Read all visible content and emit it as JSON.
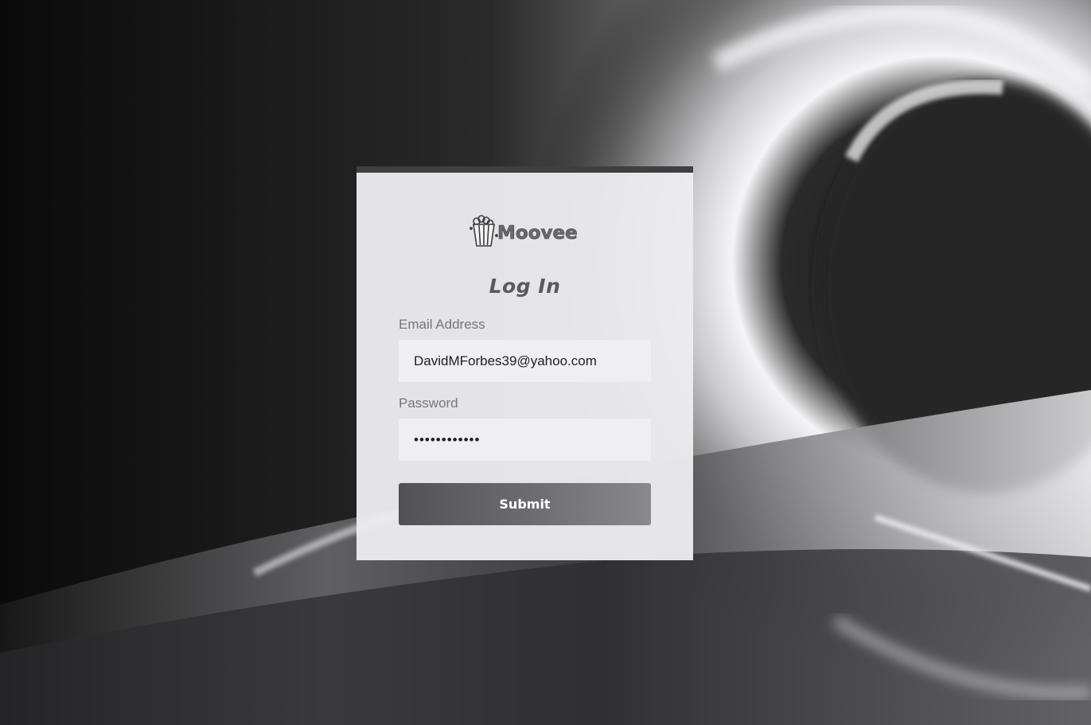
{
  "brand": {
    "name": "Moovee",
    "icon": "popcorn-icon"
  },
  "form": {
    "title": "Log In",
    "email_label": "Email Address",
    "email_value": "DavidMForbes39@yahoo.com",
    "password_label": "Password",
    "password_value": "fakepassword",
    "submit_label": "Submit"
  },
  "colors": {
    "card_accent": "#3f3f43",
    "button_start": "#525256",
    "button_end": "#8a8a8e"
  }
}
